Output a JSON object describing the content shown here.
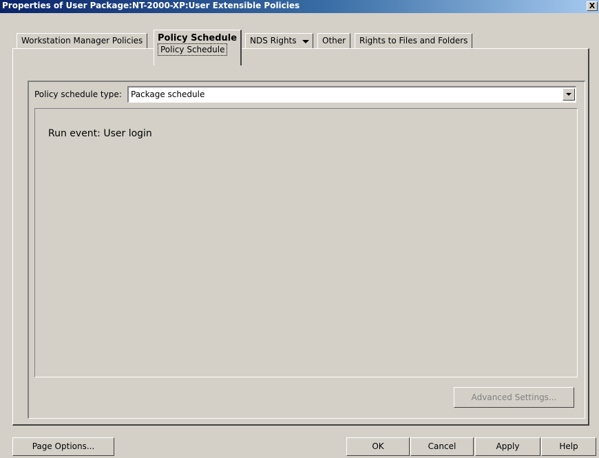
{
  "window": {
    "title": "Properties of User Package:NT-2000-XP:User Extensible Policies",
    "close_glyph": "X"
  },
  "tabs": [
    {
      "label": "Workstation Manager Policies"
    },
    {
      "label": "Policy Schedule",
      "subtab": "Policy Schedule",
      "active": true
    },
    {
      "label": "NDS Rights",
      "has_dropdown": true
    },
    {
      "label": "Other"
    },
    {
      "label": "Rights to Files and Folders"
    }
  ],
  "schedule": {
    "label": "Policy schedule type:",
    "value": "Package schedule"
  },
  "event_panel": {
    "text": "Run event: User login"
  },
  "advanced_button": {
    "label": "Advanced Settings...",
    "enabled": false
  },
  "footer": {
    "page_options": "Page Options...",
    "ok": "OK",
    "cancel": "Cancel",
    "apply": "Apply",
    "help": "Help"
  }
}
